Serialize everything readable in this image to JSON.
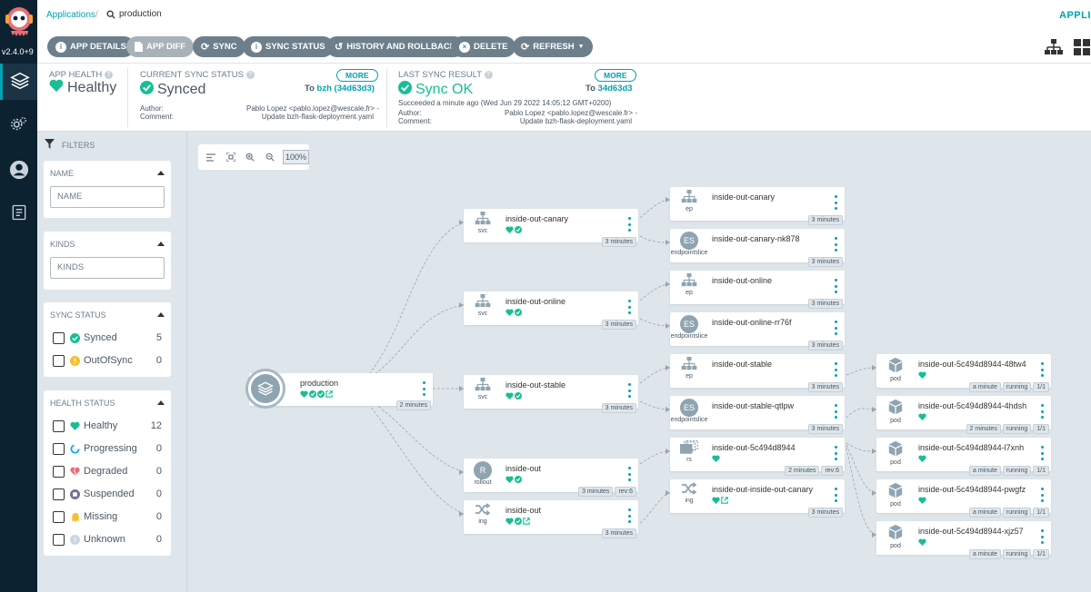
{
  "nav": {
    "version": "v2.4.0+9"
  },
  "topbar": {
    "breadcrumb": "Applications",
    "app_name": "production",
    "title": "APPLICATION DETAILS TREE"
  },
  "toolbar": {
    "app_details": "APP DETAILS",
    "app_diff": "APP DIFF",
    "sync": "SYNC",
    "sync_status": "SYNC STATUS",
    "history": "HISTORY AND ROLLBACK",
    "delete": "DELETE",
    "refresh": "REFRESH"
  },
  "status": {
    "health": {
      "label": "APP HEALTH",
      "value": "Healthy"
    },
    "current_sync": {
      "label": "CURRENT SYNC STATUS",
      "value": "Synced",
      "more": "MORE",
      "to_prefix": "To",
      "to_rev": "bzh (34d63d3)",
      "author_label": "Author:",
      "author": "Pablo Lopez <pablo.lopez@wescale.fr> -",
      "comment_label": "Comment:",
      "comment": "Update bzh-flask-deployment.yaml"
    },
    "last_sync": {
      "label": "LAST SYNC RESULT",
      "value": "Sync OK",
      "more": "MORE",
      "to_prefix": "To",
      "to_rev": "34d63d3",
      "succeeded": "Succeeded a minute ago (Wed Jun 29 2022 14:05:12 GMT+0200)",
      "author_label": "Author:",
      "author": "Pablo Lopez <pablo.lopez@wescale.fr> -",
      "comment_label": "Comment:",
      "comment": "Update bzh-flask-deployment.yaml"
    }
  },
  "filters": {
    "header": "FILTERS",
    "name": {
      "title": "NAME",
      "placeholder": "NAME"
    },
    "kinds": {
      "title": "KINDS",
      "placeholder": "KINDS"
    },
    "sync_status": {
      "title": "SYNC STATUS",
      "items": [
        {
          "label": "Synced",
          "count": "5"
        },
        {
          "label": "OutOfSync",
          "count": "0"
        }
      ]
    },
    "health_status": {
      "title": "HEALTH STATUS",
      "items": [
        {
          "label": "Healthy",
          "count": "12"
        },
        {
          "label": "Progressing",
          "count": "0"
        },
        {
          "label": "Degraded",
          "count": "0"
        },
        {
          "label": "Suspended",
          "count": "0"
        },
        {
          "label": "Missing",
          "count": "0"
        },
        {
          "label": "Unknown",
          "count": "0"
        }
      ]
    }
  },
  "zoom": {
    "level": "100%"
  },
  "graph": {
    "root": {
      "name": "production",
      "age": "2 minutes"
    },
    "level1": [
      {
        "name": "inside-out-canary",
        "kind": "svc",
        "age": "3 minutes"
      },
      {
        "name": "inside-out-online",
        "kind": "svc",
        "age": "3 minutes"
      },
      {
        "name": "inside-out-stable",
        "kind": "svc",
        "age": "3 minutes"
      },
      {
        "name": "inside-out",
        "kind": "rollout",
        "icon": "R",
        "age": "3 minutes",
        "rev": "rev:6"
      },
      {
        "name": "inside-out",
        "kind": "ing",
        "age": "3 minutes"
      }
    ],
    "level2": [
      {
        "name": "inside-out-canary",
        "kind": "ep",
        "age": "3 minutes"
      },
      {
        "name": "inside-out-canary-nk878",
        "kind": "endpointslice",
        "icon": "ES",
        "age": "3 minutes"
      },
      {
        "name": "inside-out-online",
        "kind": "ep",
        "age": "3 minutes"
      },
      {
        "name": "inside-out-online-rr76f",
        "kind": "endpointslice",
        "icon": "ES",
        "age": "3 minutes"
      },
      {
        "name": "inside-out-stable",
        "kind": "ep",
        "age": "3 minutes"
      },
      {
        "name": "inside-out-stable-qtlpw",
        "kind": "endpointslice",
        "icon": "ES",
        "age": "3 minutes"
      },
      {
        "name": "inside-out-5c494d8944",
        "kind": "rs",
        "age": "2 minutes",
        "rev": "rev:6"
      },
      {
        "name": "inside-out-inside-out-canary",
        "kind": "ing",
        "age": "3 minutes"
      }
    ],
    "pods": [
      {
        "name": "inside-out-5c494d8944-48tw4",
        "kind": "pod",
        "age": "a minute",
        "state": "running",
        "ready": "1/1"
      },
      {
        "name": "inside-out-5c494d8944-4hdsh",
        "kind": "pod",
        "age": "2 minutes",
        "state": "running",
        "ready": "1/1"
      },
      {
        "name": "inside-out-5c494d8944-l7xnh",
        "kind": "pod",
        "age": "a minute",
        "state": "running",
        "ready": "1/1"
      },
      {
        "name": "inside-out-5c494d8944-pwgfz",
        "kind": "pod",
        "age": "a minute",
        "state": "running",
        "ready": "1/1"
      },
      {
        "name": "inside-out-5c494d8944-xjz57",
        "kind": "pod",
        "age": "a minute",
        "state": "running",
        "ready": "1/1"
      }
    ]
  },
  "colors": {
    "accent": "#00a2b3",
    "healthy": "#18be94",
    "nav_bg": "#0c2231",
    "button": "#6d7f8b"
  }
}
